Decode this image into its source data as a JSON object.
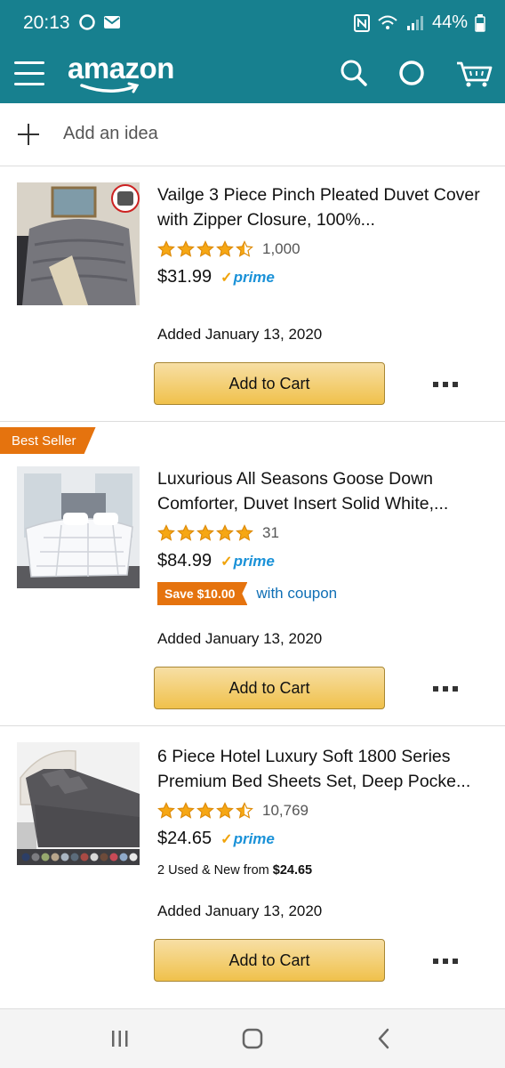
{
  "status_bar": {
    "time": "20:13",
    "battery": "44%"
  },
  "header": {
    "logo_text": "amazon"
  },
  "add_idea": {
    "label": "Add an idea"
  },
  "products": [
    {
      "title": "Vailge 3 Piece Pinch Pleated Duvet Cover with Zipper Closure, 100%...",
      "rating_stars": 4.5,
      "review_count": "1,000",
      "price": "$31.99",
      "prime_label": "prime",
      "added": "Added January 13, 2020",
      "cart_label": "Add to Cart"
    },
    {
      "badge": "Best Seller",
      "title": "Luxurious All Seasons Goose Down Comforter, Duvet Insert Solid White,...",
      "rating_stars": 5,
      "review_count": "31",
      "price": "$84.99",
      "prime_label": "prime",
      "coupon": "Save $10.00",
      "coupon_text": "with coupon",
      "added": "Added January 13, 2020",
      "cart_label": "Add to Cart"
    },
    {
      "title": "6 Piece Hotel Luxury Soft 1800 Series Premium Bed Sheets Set, Deep Pocke...",
      "rating_stars": 4.5,
      "review_count": "10,769",
      "price": "$24.65",
      "prime_label": "prime",
      "used_prefix": "2 Used & New",
      "used_from": "from",
      "used_price": "$24.65",
      "added": "Added January 13, 2020",
      "cart_label": "Add to Cart"
    }
  ],
  "colors": {
    "header": "#17808f",
    "star": "#f6a714",
    "button": "#f0c14b",
    "badge": "#e5730e",
    "prime": "#1b92d8"
  }
}
